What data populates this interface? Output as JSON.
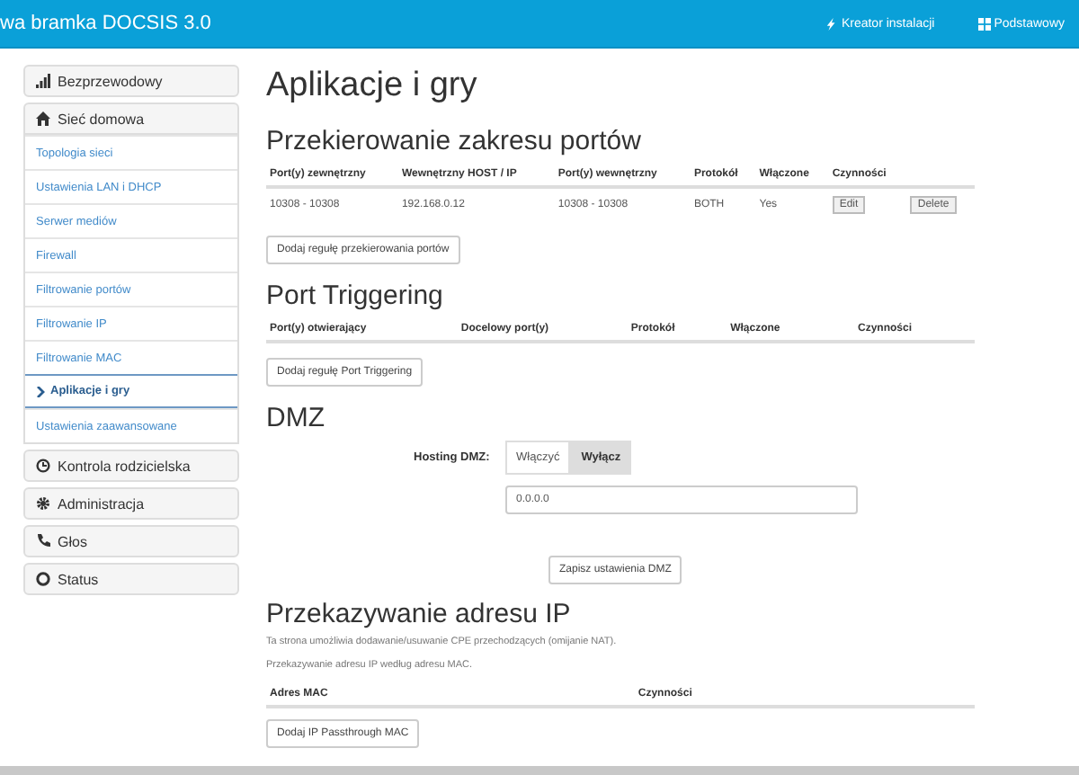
{
  "header": {
    "title": "wa bramka DOCSIS 3.0",
    "links": [
      {
        "label": "Kreator instalacji",
        "kind": "bolt"
      },
      {
        "label": "Podstawowy",
        "kind": "grid"
      }
    ]
  },
  "sidebar": {
    "groups": [
      {
        "label": "Bezprzewodowy",
        "kind": "signal",
        "expanded": false
      },
      {
        "label": "Sieć domowa",
        "kind": "home",
        "expanded": true,
        "children": [
          {
            "label": "Topologia sieci",
            "selected": false
          },
          {
            "label": "Ustawienia LAN i DHCP",
            "selected": false
          },
          {
            "label": "Serwer mediów",
            "selected": false
          },
          {
            "label": "Firewall",
            "selected": false
          },
          {
            "label": "Filtrowanie portów",
            "selected": false
          },
          {
            "label": "Filtrowanie IP",
            "selected": false
          },
          {
            "label": "Filtrowanie MAC",
            "selected": false
          },
          {
            "label": "Aplikacje i gry",
            "selected": true
          },
          {
            "label": "Ustawienia zaawansowane",
            "selected": false
          }
        ]
      },
      {
        "label": "Kontrola rodzicielska",
        "kind": "clock",
        "expanded": false
      },
      {
        "label": "Administracja",
        "kind": "gear",
        "expanded": false
      },
      {
        "label": "Głos",
        "kind": "phone",
        "expanded": false
      },
      {
        "label": "Status",
        "kind": "ring",
        "expanded": false
      }
    ]
  },
  "page_title": "Aplikacje i gry",
  "port_range": {
    "title": "Przekierowanie zakresu portów",
    "columns": [
      "Port(y) zewnętrzny",
      "Wewnętrzny HOST / IP",
      "Port(y) wewnętrzny",
      "Protokół",
      "Włączone",
      "Czynności"
    ],
    "rows": [
      {
        "cells": [
          "10308 - 10308",
          "192.168.0.12",
          "10308 - 10308",
          "BOTH",
          "Yes"
        ],
        "actions": [
          "Edit",
          "Delete"
        ]
      }
    ],
    "add_button": "Dodaj regułę przekierowania portów"
  },
  "port_triggering": {
    "title": "Port Triggering",
    "columns": [
      "Port(y) otwierający",
      "Docelowy port(y)",
      "Protokół",
      "Włączone",
      "Czynności"
    ],
    "add_button": "Dodaj regułę Port Triggering"
  },
  "dmz": {
    "title": "DMZ",
    "label": "Hosting DMZ:",
    "options": [
      {
        "label": "Włączyć",
        "selected": false
      },
      {
        "label": "Wyłącz",
        "selected": true
      }
    ],
    "address": "0.0.0.0",
    "save_button": "Zapisz ustawienia DMZ"
  },
  "ip_passthrough": {
    "title": "Przekazywanie adresu IP",
    "description": "Ta strona umożliwia dodawanie/usuwanie CPE przechodzących (omijanie NAT).",
    "subtitle": "Przekazywanie adresu IP według adresu MAC.",
    "columns": [
      "Adres MAC",
      "Czynności"
    ],
    "add_button": "Dodaj IP Passthrough MAC"
  }
}
